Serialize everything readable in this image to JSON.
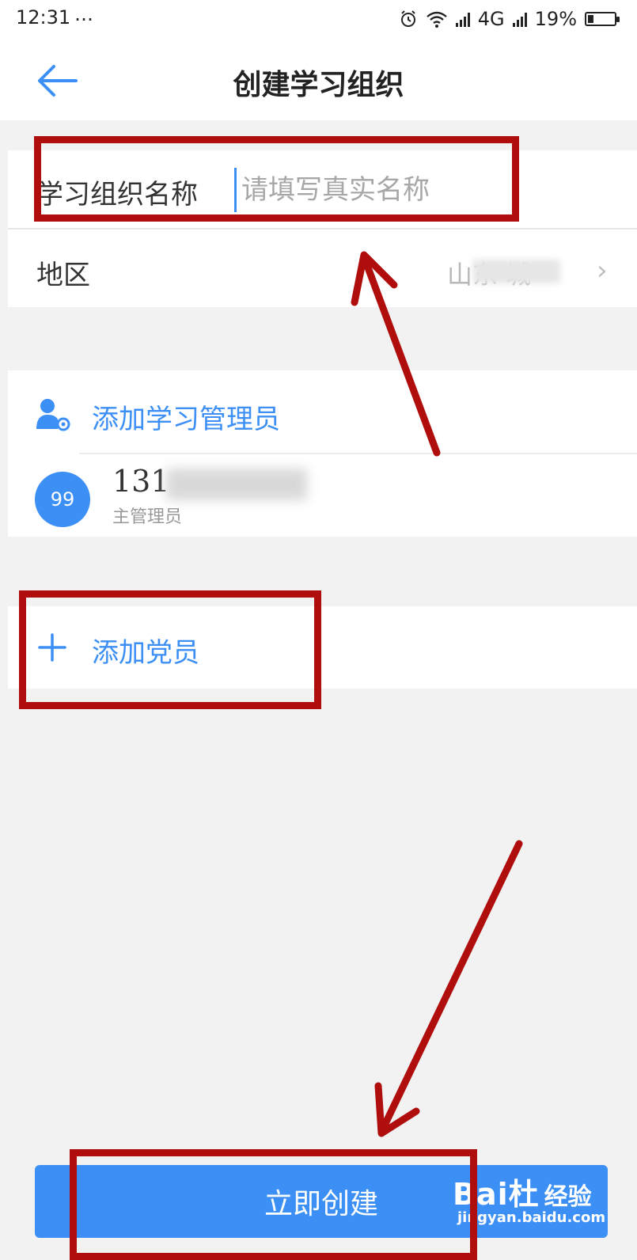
{
  "status_bar": {
    "time": "12:31",
    "more": "…",
    "network": "4G",
    "battery": "19%"
  },
  "header": {
    "back_icon": "arrow-left-icon",
    "title": "创建学习组织"
  },
  "form": {
    "name_label": "学习组织名称",
    "name_placeholder": "请填写真实名称",
    "name_value": "",
    "region_label": "地区",
    "region_value": "山东  城",
    "chevron": "›"
  },
  "admin": {
    "add_label": "添加学习管理员",
    "avatar_text": "99",
    "phone": "131",
    "role": "主管理员"
  },
  "members": {
    "add_label": "添加党员"
  },
  "footer": {
    "create_label": "立即创建"
  },
  "watermark": {
    "brand": "Bai杜",
    "brand_cn": "经验",
    "url": "jingyan.baidu.com"
  },
  "colors": {
    "accent": "#3b8ff5",
    "annotation": "#b00d0d",
    "background": "#f2f2f2"
  }
}
